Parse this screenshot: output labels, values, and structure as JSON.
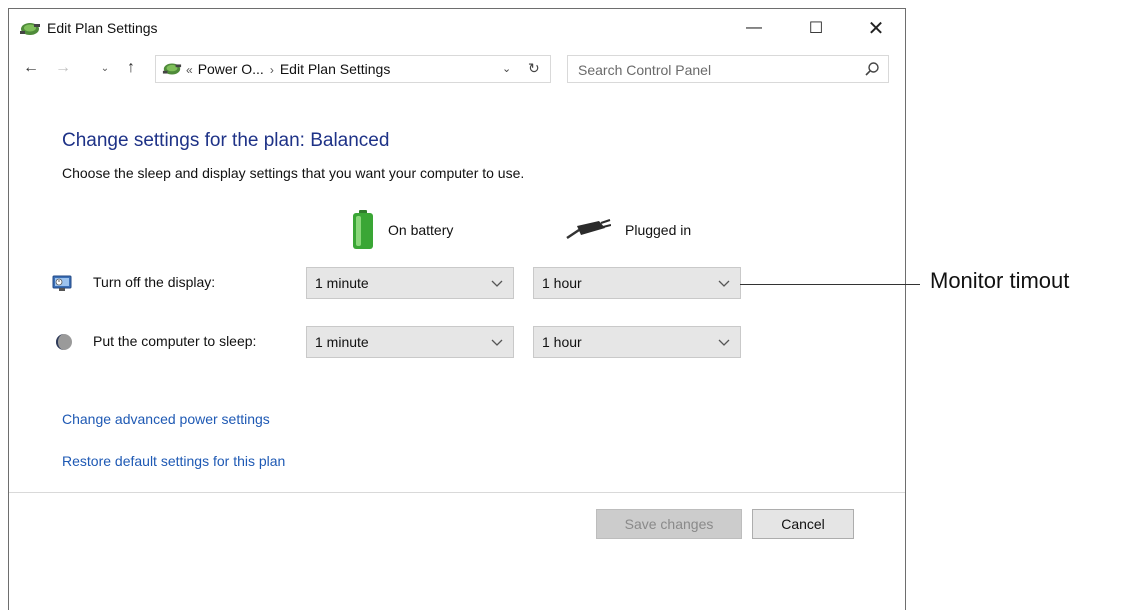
{
  "window": {
    "title": "Edit Plan Settings",
    "controls": {
      "minimize": "—",
      "maximize": "☐",
      "close": "✕"
    }
  },
  "navigation": {
    "back": "←",
    "forward": "→",
    "recent": "⌄",
    "up": "↑",
    "address": {
      "overflow": "«",
      "crumbs": [
        "Power O...",
        "Edit Plan Settings"
      ],
      "separator": "›",
      "dropdown": "⌄",
      "refresh": "↻"
    },
    "search": {
      "placeholder": "Search Control Panel"
    }
  },
  "content": {
    "heading": "Change settings for the plan: Balanced",
    "subtitle": "Choose the sleep and display settings that you want your computer to use.",
    "columns": {
      "battery": "On battery",
      "plugged": "Plugged in"
    },
    "rows": [
      {
        "label": "Turn off the display:",
        "battery_value": "1 minute",
        "plugged_value": "1 hour",
        "icon": "display-icon"
      },
      {
        "label": "Put the computer to sleep:",
        "battery_value": "1 minute",
        "plugged_value": "1 hour",
        "icon": "sleep-icon"
      }
    ],
    "links": {
      "advanced": "Change advanced power settings",
      "restore": "Restore default settings for this plan"
    }
  },
  "buttons": {
    "save": "Save changes",
    "cancel": "Cancel"
  },
  "callout": {
    "text": "Monitor timout"
  },
  "colors": {
    "heading": "#1e3287",
    "link": "#1e59b4",
    "dropdown_bg": "#e6e6e6",
    "battery_green": "#3aa635"
  }
}
